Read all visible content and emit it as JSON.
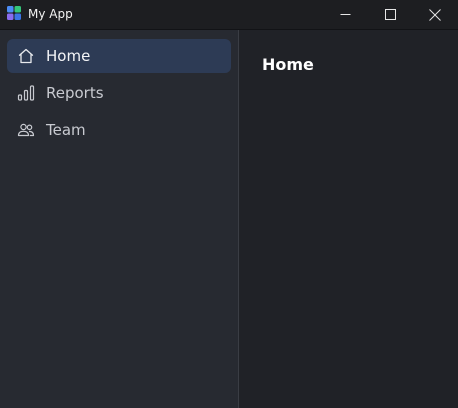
{
  "window": {
    "title": "My App",
    "controls": [
      "minimize",
      "maximize",
      "close"
    ]
  },
  "sidebar": {
    "items": [
      {
        "label": "Home",
        "icon": "home-icon",
        "selected": true
      },
      {
        "label": "Reports",
        "icon": "bar-chart-icon",
        "selected": false
      },
      {
        "label": "Team",
        "icon": "people-icon",
        "selected": false
      }
    ]
  },
  "main": {
    "title": "Home"
  },
  "colors": {
    "titlebar": "#1d1e21",
    "sidebar": "#272a31",
    "content": "#202227",
    "selected_item": "#2d3b55"
  }
}
